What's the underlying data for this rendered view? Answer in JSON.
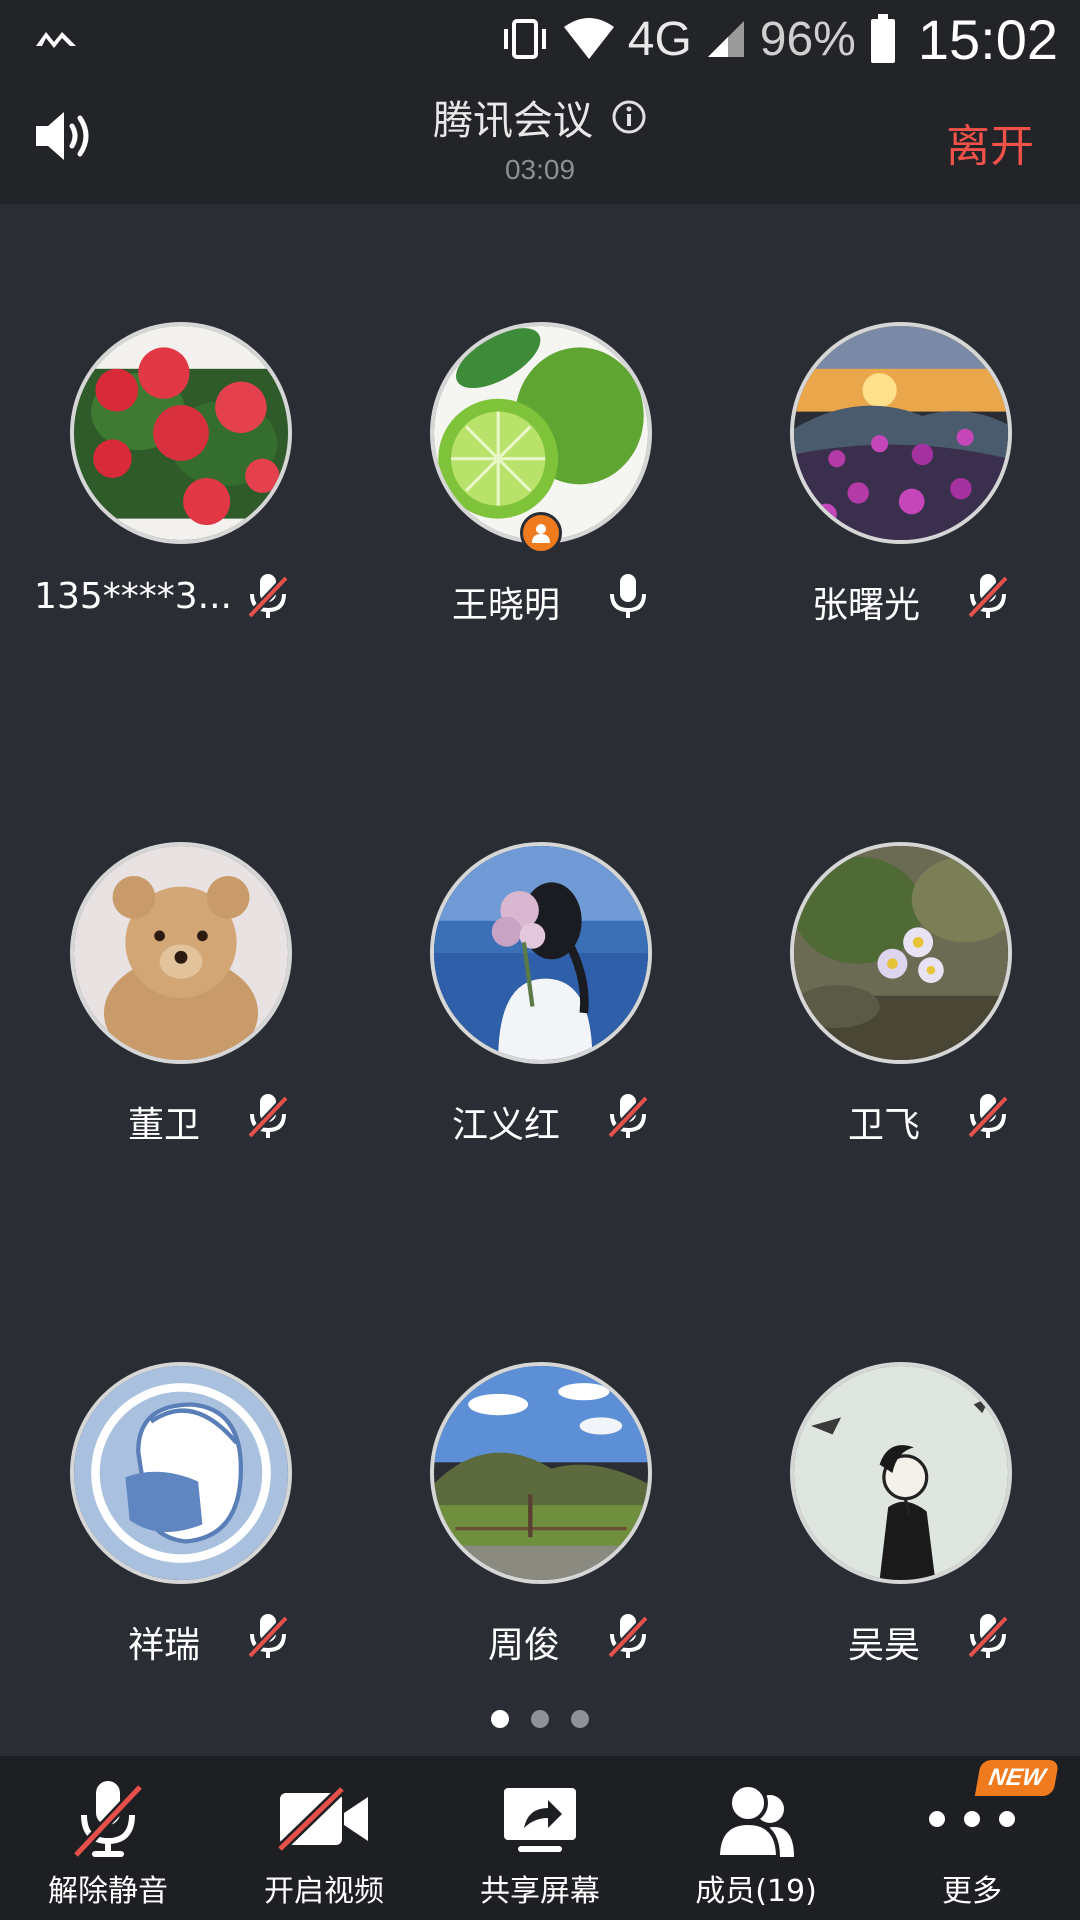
{
  "statusbar": {
    "network": "4G",
    "battery_pct": "96%",
    "time": "15:02"
  },
  "header": {
    "title": "腾讯会议",
    "timer": "03:09",
    "leave_label": "离开"
  },
  "participants": [
    {
      "name": "135****3...",
      "muted": true,
      "host": false,
      "avatar": "red-flowers"
    },
    {
      "name": "王晓明",
      "muted": false,
      "host": true,
      "avatar": "limes"
    },
    {
      "name": "张曙光",
      "muted": true,
      "host": false,
      "avatar": "purple-flowers-sunset"
    },
    {
      "name": "董卫",
      "muted": true,
      "host": false,
      "avatar": "teddy-bear"
    },
    {
      "name": "江义红",
      "muted": true,
      "host": false,
      "avatar": "girl-with-flowers"
    },
    {
      "name": "卫飞",
      "muted": true,
      "host": false,
      "avatar": "daisies-on-rock"
    },
    {
      "name": "祥瑞",
      "muted": true,
      "host": false,
      "avatar": "masked-person"
    },
    {
      "name": "周俊",
      "muted": true,
      "host": false,
      "avatar": "valley-landscape"
    },
    {
      "name": "吴昊",
      "muted": true,
      "host": false,
      "avatar": "sketch-woman"
    }
  ],
  "pager": {
    "pages": 3,
    "active": 1
  },
  "toolbar": {
    "unmute": "解除静音",
    "start_video": "开启视频",
    "share_screen": "共享屏幕",
    "members": "成员(19)",
    "more": "更多",
    "new_badge": "NEW"
  },
  "colors": {
    "background": "#2a2d33",
    "header": "#222428",
    "toolbar": "#1d1f23",
    "leave": "#f2514a",
    "mute_slash": "#e5504b",
    "host_badge": "#f07a1e"
  }
}
